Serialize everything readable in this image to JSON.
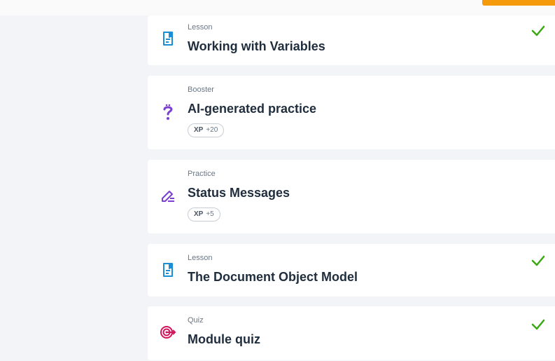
{
  "items": [
    {
      "type": "Lesson",
      "title": "Working with Variables",
      "icon": "lesson-document-icon",
      "completed": true
    },
    {
      "type": "Booster",
      "title": "AI-generated practice",
      "icon": "question-mark-icon",
      "xp_label": "XP",
      "xp_value": "+20",
      "completed": false
    },
    {
      "type": "Practice",
      "title": "Status Messages",
      "icon": "pencil-edit-icon",
      "xp_label": "XP",
      "xp_value": "+5",
      "completed": false
    },
    {
      "type": "Lesson",
      "title": "The Document Object Model",
      "icon": "lesson-document-icon",
      "completed": true
    },
    {
      "type": "Quiz",
      "title": "Module quiz",
      "icon": "target-icon",
      "completed": true
    }
  ],
  "colors": {
    "lesson_icon": "#1a8fd6",
    "booster_icon": "#7b3fd1",
    "practice_icon": "#7b3fd1",
    "quiz_icon": "#d4145a",
    "check": "#3aa812",
    "accent": "#f59a0b"
  }
}
